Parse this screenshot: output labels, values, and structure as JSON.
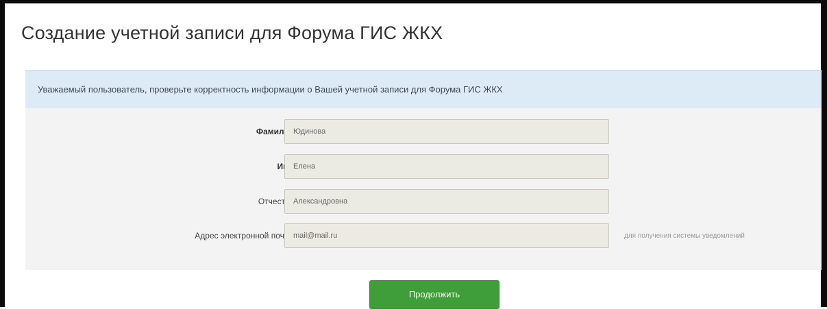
{
  "page": {
    "title": "Создание учетной записи для Форума ГИС ЖКХ"
  },
  "notice": {
    "text": "Уважаемый пользователь, проверьте корректность информации о Вашей учетной записи для Форума ГИС ЖКХ"
  },
  "form": {
    "fields": [
      {
        "label": "Фамилия",
        "value": "Юдинова"
      },
      {
        "label": "Имя",
        "value": "Елена"
      },
      {
        "label": "Отчество",
        "value": "Александровна"
      },
      {
        "label": "Адрес электронной почты",
        "value": "mail@mail.ru",
        "hint": "для получения системы уведомлений"
      }
    ]
  },
  "actions": {
    "continue_label": "Продолжить"
  },
  "colors": {
    "notice_bg": "#dcebf6",
    "form_bg": "#f3f3f3",
    "field_bg": "#ecebe3",
    "button_bg": "#3f9e3a"
  }
}
